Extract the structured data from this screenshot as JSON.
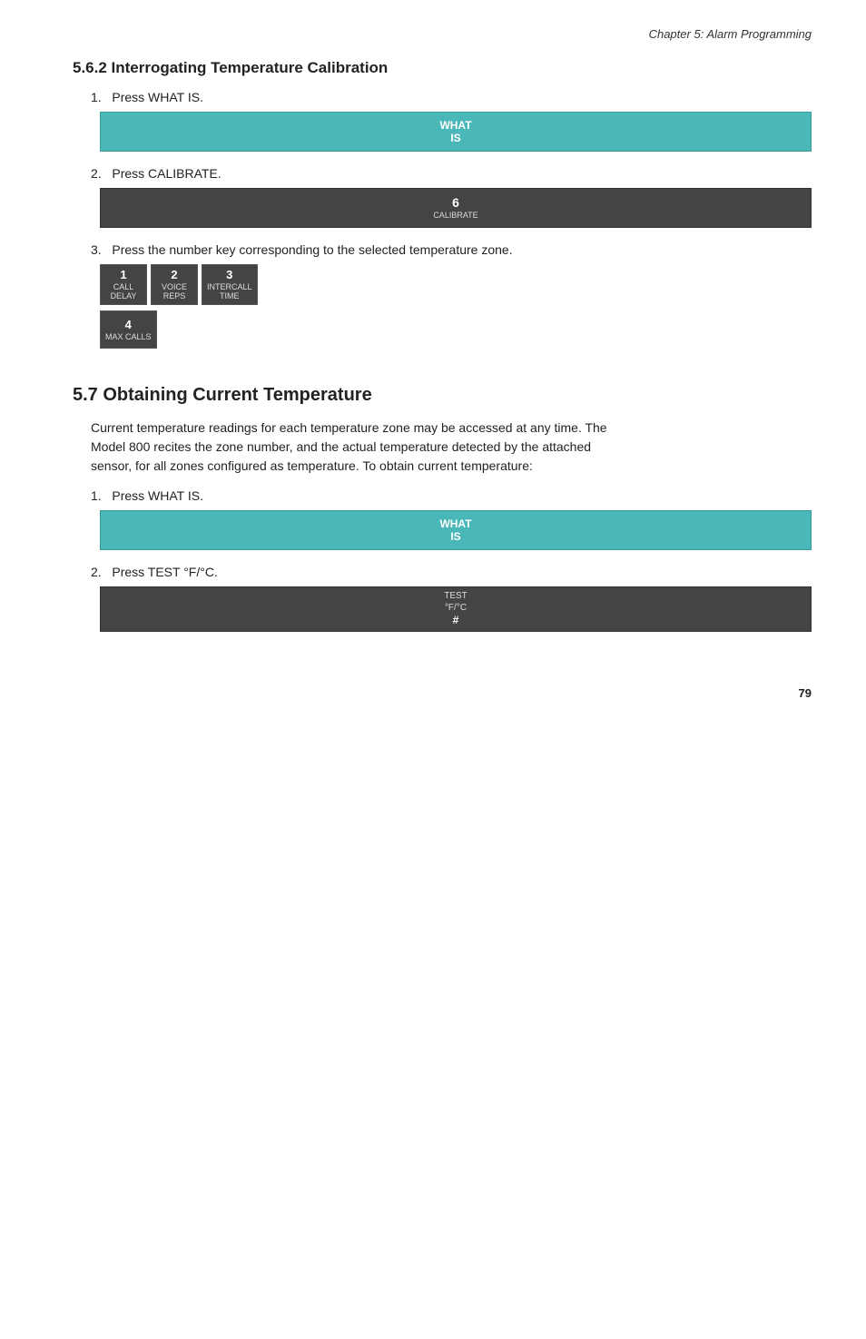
{
  "chapter_header": "Chapter 5: Alarm Programming",
  "section1": {
    "title": "5.6.2  Interrogating Temperature Calibration",
    "steps": [
      {
        "number": "1.",
        "text": "Press WHAT IS.",
        "button_type": "whatis",
        "button_lines": [
          "WHAT",
          "IS"
        ]
      },
      {
        "number": "2.",
        "text": "Press CALIBRATE.",
        "button_type": "calibrate",
        "cal_number": "6",
        "cal_label": "CALIBRATE"
      },
      {
        "number": "3.",
        "text": "Press the number key corresponding to the selected temperature zone.",
        "button_type": "numkeys"
      }
    ],
    "numkeys": [
      {
        "number": "1",
        "line1": "CALL",
        "line2": "DELAY"
      },
      {
        "number": "2",
        "line1": "VOICE",
        "line2": "REPS"
      },
      {
        "number": "3",
        "line1": "INTERCALL",
        "line2": "TIME"
      },
      {
        "number": "4",
        "line1": "MAX CALLS",
        "line2": ""
      }
    ]
  },
  "section2": {
    "title": "5.7  Obtaining Current Temperature",
    "body": "Current temperature readings for each temperature zone may be accessed at any time. The Model 800 recites the zone number, and the actual temperature detected by the attached sensor, for all zones configured as temperature. To obtain current temperature:",
    "steps": [
      {
        "number": "1.",
        "text": "Press WHAT IS.",
        "button_type": "whatis",
        "button_lines": [
          "WHAT",
          "IS"
        ]
      },
      {
        "number": "2.",
        "text": "Press TEST °F/°C.",
        "button_type": "test",
        "test_lines": [
          "TEST",
          "°F/°C",
          "#"
        ]
      }
    ]
  },
  "page_number": "79"
}
